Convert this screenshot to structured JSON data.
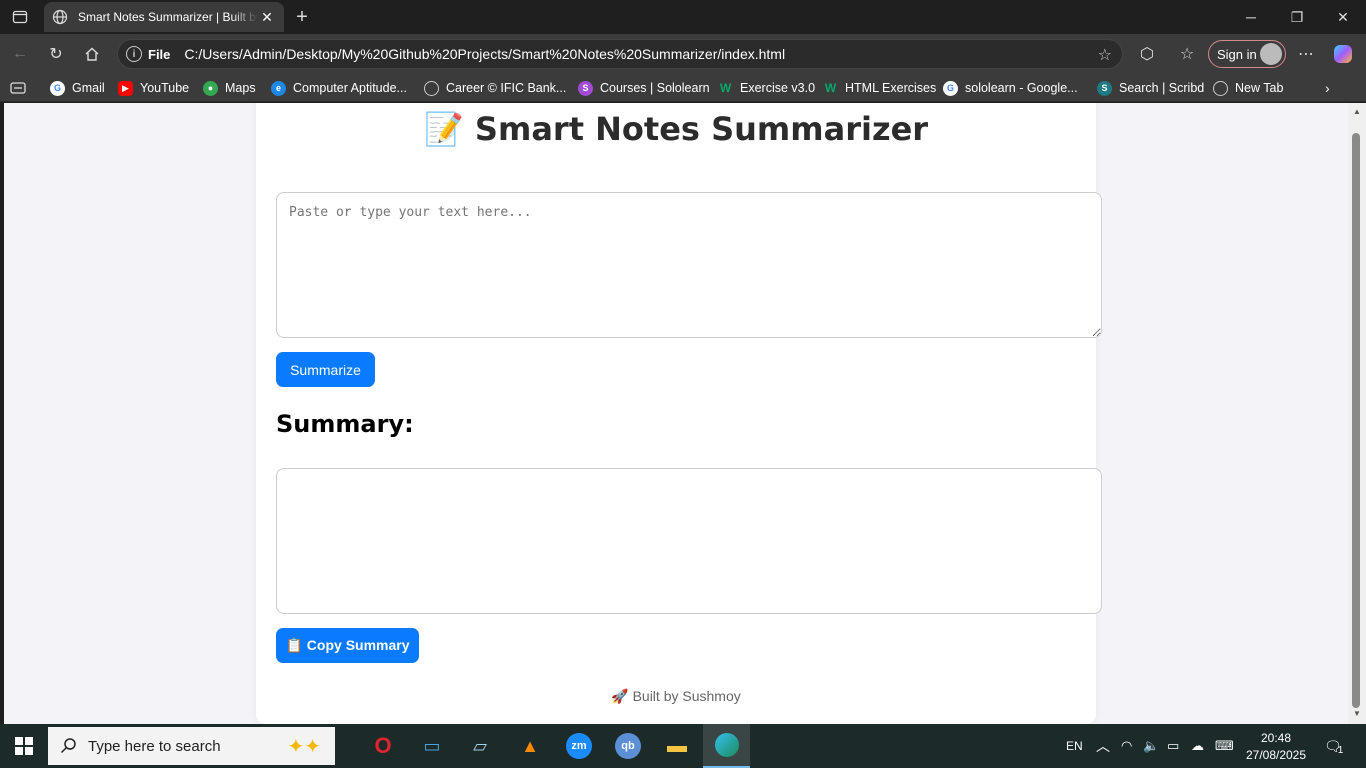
{
  "browser": {
    "tab_title": "Smart Notes Summarizer | Built by Sushmoy",
    "address_scheme": "File",
    "address_url": "C:/Users/Admin/Desktop/My%20Github%20Projects/Smart%20Notes%20Summarizer/index.html",
    "signin_label": "Sign in",
    "bookmarks": [
      {
        "label": "Gmail",
        "icon": "google-icon",
        "color": "#ffffff"
      },
      {
        "label": "YouTube",
        "icon": "youtube-icon",
        "color": "#ff0000"
      },
      {
        "label": "Maps",
        "icon": "maps-icon",
        "color": "#34a853"
      },
      {
        "label": "Computer Aptitude...",
        "icon": "edge-icon",
        "color": "#1e88e5"
      },
      {
        "label": "Career © IFIC Bank...",
        "icon": "globe-icon",
        "color": "#cccccc"
      },
      {
        "label": "Courses | Sololearn",
        "icon": "sololearn-icon",
        "color": "#a24bd6"
      },
      {
        "label": "Exercise v3.0",
        "icon": "w3schools-icon",
        "color": "#04aa6d"
      },
      {
        "label": "HTML Exercises",
        "icon": "w3schools-icon",
        "color": "#04aa6d"
      },
      {
        "label": "sololearn - Google...",
        "icon": "google-icon",
        "color": "#ffffff"
      },
      {
        "label": "Search | Scribd",
        "icon": "scribd-icon",
        "color": "#1e7b85"
      },
      {
        "label": "New Tab",
        "icon": "globe-icon",
        "color": "#cccccc"
      }
    ]
  },
  "page": {
    "title": "📝 Smart Notes Summarizer",
    "input_placeholder": "Paste or type your text here...",
    "summarize_label": "Summarize",
    "summary_heading": "Summary:",
    "copy_label": "📋 Copy Summary",
    "footer": "🚀 Built by Sushmoy",
    "accent_color": "#0a7bff"
  },
  "taskbar": {
    "search_placeholder": "Type here to search",
    "language": "EN",
    "time": "20:48",
    "date": "27/08/2025",
    "notification_count": "1"
  }
}
